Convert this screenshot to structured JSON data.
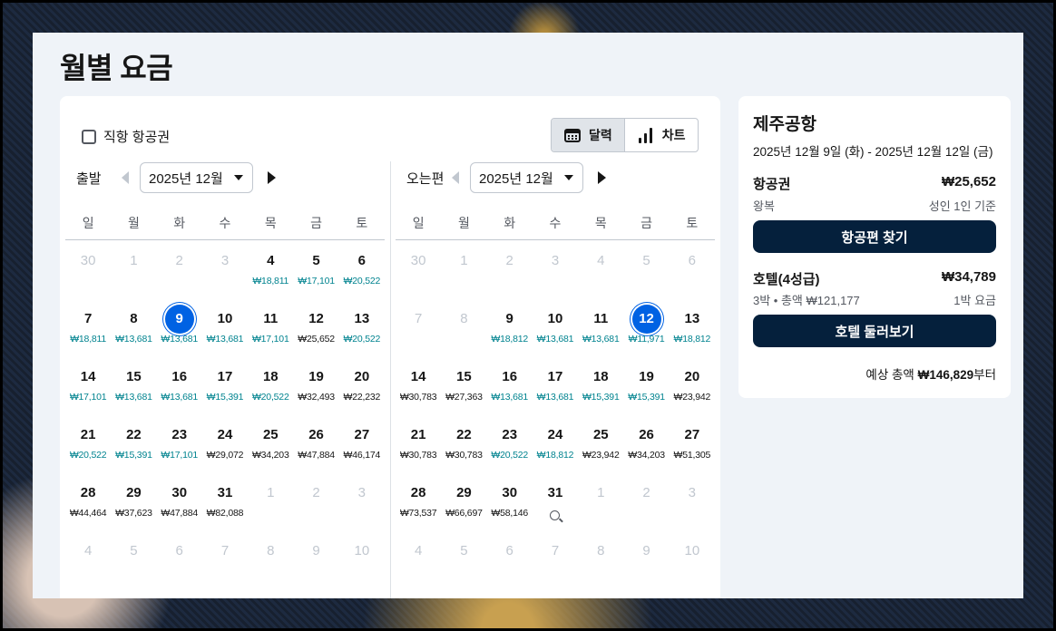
{
  "page": {
    "title": "월별 요금"
  },
  "filters": {
    "direct_label": "직항 항공권",
    "direct_checked": false
  },
  "view_toggle": {
    "calendar": "달력",
    "chart": "차트",
    "active": "calendar"
  },
  "weekdays": [
    "일",
    "월",
    "화",
    "수",
    "목",
    "금",
    "토"
  ],
  "colors": {
    "selected": "#0062e3",
    "low_price": "#00838f",
    "button": "#05203c"
  },
  "departure": {
    "label": "출발",
    "month": "2025년 12월",
    "days": [
      {
        "d": "30",
        "m": true
      },
      {
        "d": "1",
        "m": true
      },
      {
        "d": "2",
        "m": true
      },
      {
        "d": "3",
        "m": true
      },
      {
        "d": "4",
        "p": "₩18,811",
        "low": true
      },
      {
        "d": "5",
        "p": "₩17,101",
        "low": true
      },
      {
        "d": "6",
        "p": "₩20,522",
        "low": true
      },
      {
        "d": "7",
        "p": "₩18,811",
        "low": true
      },
      {
        "d": "8",
        "p": "₩13,681",
        "low": true
      },
      {
        "d": "9",
        "p": "₩13,681",
        "low": true,
        "sel": true
      },
      {
        "d": "10",
        "p": "₩13,681",
        "low": true
      },
      {
        "d": "11",
        "p": "₩17,101",
        "low": true
      },
      {
        "d": "12",
        "p": "₩25,652"
      },
      {
        "d": "13",
        "p": "₩20,522",
        "low": true
      },
      {
        "d": "14",
        "p": "₩17,101",
        "low": true
      },
      {
        "d": "15",
        "p": "₩13,681",
        "low": true
      },
      {
        "d": "16",
        "p": "₩13,681",
        "low": true
      },
      {
        "d": "17",
        "p": "₩15,391",
        "low": true
      },
      {
        "d": "18",
        "p": "₩20,522",
        "low": true
      },
      {
        "d": "19",
        "p": "₩32,493"
      },
      {
        "d": "20",
        "p": "₩22,232"
      },
      {
        "d": "21",
        "p": "₩20,522",
        "low": true
      },
      {
        "d": "22",
        "p": "₩15,391",
        "low": true
      },
      {
        "d": "23",
        "p": "₩17,101",
        "low": true
      },
      {
        "d": "24",
        "p": "₩29,072"
      },
      {
        "d": "25",
        "p": "₩34,203"
      },
      {
        "d": "26",
        "p": "₩47,884"
      },
      {
        "d": "27",
        "p": "₩46,174"
      },
      {
        "d": "28",
        "p": "₩44,464"
      },
      {
        "d": "29",
        "p": "₩37,623"
      },
      {
        "d": "30",
        "p": "₩47,884"
      },
      {
        "d": "31",
        "p": "₩82,088"
      },
      {
        "d": "1",
        "m": true
      },
      {
        "d": "2",
        "m": true
      },
      {
        "d": "3",
        "m": true
      },
      {
        "d": "4",
        "m": true
      },
      {
        "d": "5",
        "m": true
      },
      {
        "d": "6",
        "m": true
      },
      {
        "d": "7",
        "m": true
      },
      {
        "d": "8",
        "m": true
      },
      {
        "d": "9",
        "m": true
      },
      {
        "d": "10",
        "m": true
      }
    ]
  },
  "return": {
    "label": "오는편",
    "month": "2025년 12월",
    "days": [
      {
        "d": "30",
        "m": true
      },
      {
        "d": "1",
        "m": true
      },
      {
        "d": "2",
        "m": true
      },
      {
        "d": "3",
        "m": true
      },
      {
        "d": "4",
        "m": true
      },
      {
        "d": "5",
        "m": true
      },
      {
        "d": "6",
        "m": true
      },
      {
        "d": "7",
        "m": true
      },
      {
        "d": "8",
        "m": true
      },
      {
        "d": "9",
        "p": "₩18,812",
        "low": true
      },
      {
        "d": "10",
        "p": "₩13,681",
        "low": true
      },
      {
        "d": "11",
        "p": "₩13,681",
        "low": true
      },
      {
        "d": "12",
        "p": "₩11,971",
        "low": true,
        "sel": true
      },
      {
        "d": "13",
        "p": "₩18,812",
        "low": true
      },
      {
        "d": "14",
        "p": "₩30,783"
      },
      {
        "d": "15",
        "p": "₩27,363"
      },
      {
        "d": "16",
        "p": "₩13,681",
        "low": true
      },
      {
        "d": "17",
        "p": "₩13,681",
        "low": true
      },
      {
        "d": "18",
        "p": "₩15,391",
        "low": true
      },
      {
        "d": "19",
        "p": "₩15,391",
        "low": true
      },
      {
        "d": "20",
        "p": "₩23,942"
      },
      {
        "d": "21",
        "p": "₩30,783"
      },
      {
        "d": "22",
        "p": "₩30,783"
      },
      {
        "d": "23",
        "p": "₩20,522",
        "low": true
      },
      {
        "d": "24",
        "p": "₩18,812",
        "low": true
      },
      {
        "d": "25",
        "p": "₩23,942"
      },
      {
        "d": "26",
        "p": "₩34,203"
      },
      {
        "d": "27",
        "p": "₩51,305"
      },
      {
        "d": "28",
        "p": "₩73,537"
      },
      {
        "d": "29",
        "p": "₩66,697"
      },
      {
        "d": "30",
        "p": "₩58,146"
      },
      {
        "d": "31",
        "icon": "search-icon"
      },
      {
        "d": "1",
        "m": true
      },
      {
        "d": "2",
        "m": true
      },
      {
        "d": "3",
        "m": true
      },
      {
        "d": "4",
        "m": true
      },
      {
        "d": "5",
        "m": true
      },
      {
        "d": "6",
        "m": true
      },
      {
        "d": "7",
        "m": true
      },
      {
        "d": "8",
        "m": true
      },
      {
        "d": "9",
        "m": true
      },
      {
        "d": "10",
        "m": true
      }
    ]
  },
  "summary": {
    "destination": "제주공항",
    "dates": "2025년 12월 9일 (화) - 2025년 12월 12일 (금)",
    "flight": {
      "label": "항공권",
      "price": "₩25,652",
      "type": "왕복",
      "basis": "성인 1인 기준",
      "button": "항공편 찾기"
    },
    "hotel": {
      "label": "호텔(4성급)",
      "price": "₩34,789",
      "detail": "3박 • 총액 ₩121,177",
      "basis": "1박 요금",
      "button": "호텔 둘러보기"
    },
    "total": {
      "prefix": "예상 총액",
      "amount": "₩146,829",
      "suffix": "부터"
    }
  }
}
